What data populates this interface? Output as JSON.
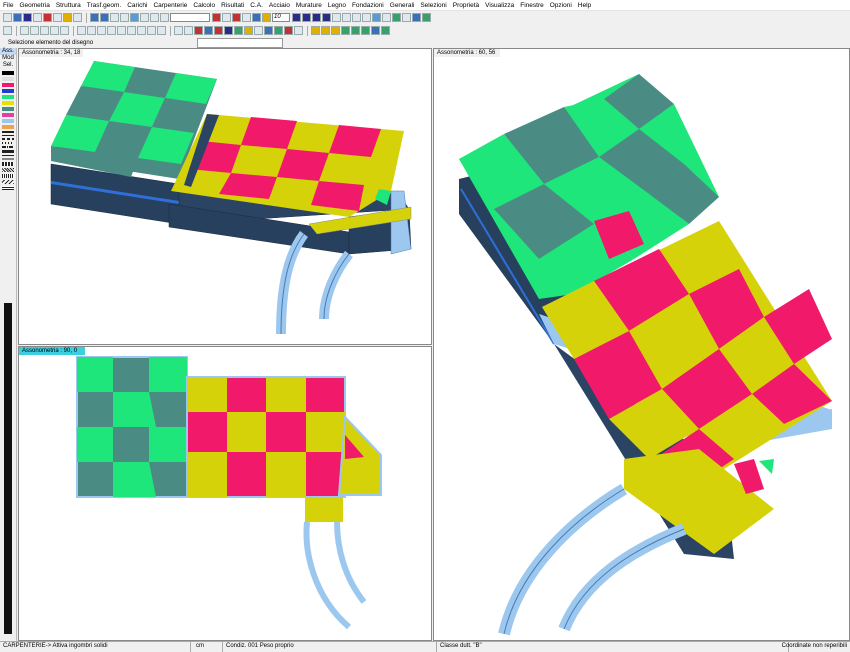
{
  "menu": [
    "File",
    "Geometria",
    "Struttura",
    "Trasf.geom.",
    "Carichi",
    "Carpenterie",
    "Calcolo",
    "Risultati",
    "C.A.",
    "Acciaio",
    "Murature",
    "Legno",
    "Fondazioni",
    "Generali",
    "Selezioni",
    "Proprietà",
    "Visualizza",
    "Finestre",
    "Opzioni",
    "Help"
  ],
  "toolbar": {
    "zoom_value": "10"
  },
  "selection": {
    "label": "Selezione  elemento del disegno"
  },
  "palette": {
    "labels": [
      "Ass.",
      "Mod",
      "Sel."
    ]
  },
  "viewports": {
    "top_left": {
      "title": "Assonometria : 34, 18"
    },
    "right": {
      "title": "Assonometria : 60, 56"
    },
    "bottom_left": {
      "title": "Assonometria : 90, 0"
    }
  },
  "colors": {
    "yellow": "#d6d20a",
    "magenta": "#f0196a",
    "green": "#1ee67a",
    "teal": "#4a8c84",
    "navy": "#27405e",
    "lightblue": "#9cc8f0",
    "active_title": "#3ccfe0"
  },
  "status": {
    "mode": "CARPENTERIE-> Attiva ingombri solidi",
    "unit": "cm",
    "condition": "Condiz.  001   Peso proprio",
    "class": "Classe dutt. \"B\"",
    "coords": "Coordinate non reperibili"
  }
}
